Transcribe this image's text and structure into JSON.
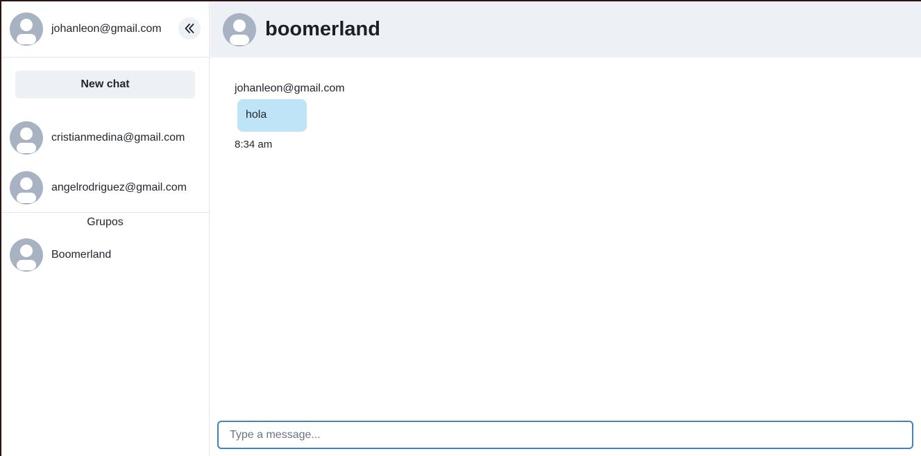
{
  "sidebar": {
    "current_user": "johanleon@gmail.com",
    "collapse_icon": "double-chevron-left-icon",
    "new_chat_label": "New chat",
    "contacts": [
      {
        "name": "cristianmedina@gmail.com"
      },
      {
        "name": "angelrodriguez@gmail.com"
      }
    ],
    "groups_title": "Grupos",
    "groups": [
      {
        "name": "Boomerland"
      }
    ]
  },
  "chat": {
    "title": "boomerland",
    "messages": [
      {
        "sender": "johanleon@gmail.com",
        "text": "hola",
        "time": "8:34 am"
      }
    ],
    "input_placeholder": "Type a message...",
    "input_value": ""
  },
  "colors": {
    "header_bg": "#edf1f5",
    "bubble_bg": "#bfe3f7",
    "avatar_bg": "#a7b2c2",
    "input_border": "#3f82c4"
  }
}
